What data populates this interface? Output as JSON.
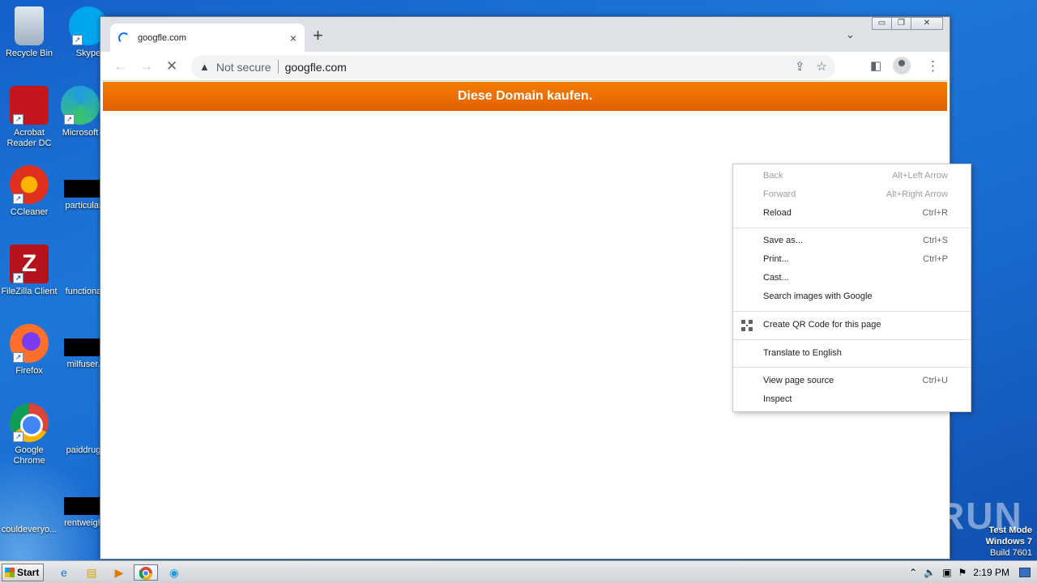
{
  "desktop": {
    "icons": [
      {
        "label": "Recycle Bin"
      },
      {
        "label": "Skype"
      },
      {
        "label": "Acrobat Reader DC"
      },
      {
        "label": "Microsoft"
      },
      {
        "label": "CCleaner"
      },
      {
        "label": "particular"
      },
      {
        "label": "FileZilla Client"
      },
      {
        "label": "functiona"
      },
      {
        "label": "Firefox"
      },
      {
        "label": "milfuser."
      },
      {
        "label": "Google Chrome"
      },
      {
        "label": "paiddrug"
      },
      {
        "label": "couldeveryo..."
      },
      {
        "label": "rentweigh"
      }
    ]
  },
  "browser": {
    "tab": {
      "title": "googfle.com",
      "close_icon": "×"
    },
    "new_tab_icon": "+",
    "tab_search_icon": "⌄",
    "window_buttons": {
      "minimize": "▭",
      "maximize": "❐",
      "close": "✕"
    },
    "toolbar": {
      "back_icon": "←",
      "forward_icon": "→",
      "stop_icon": "✕",
      "security_icon": "▲",
      "security_text": "Not secure",
      "url": "googfle.com",
      "share_icon": "⇪",
      "star_icon": "☆",
      "sidepanel_icon": "◧",
      "menu_icon": "⋮"
    },
    "page": {
      "banner_text": "Diese Domain kaufen.",
      "banner_color": "#f07000"
    }
  },
  "context_menu": {
    "items": [
      {
        "label": "Back",
        "shortcut": "Alt+Left Arrow",
        "disabled": true
      },
      {
        "label": "Forward",
        "shortcut": "Alt+Right Arrow",
        "disabled": true
      },
      {
        "label": "Reload",
        "shortcut": "Ctrl+R",
        "disabled": false
      },
      {
        "label": "Save as...",
        "shortcut": "Ctrl+S",
        "disabled": false
      },
      {
        "label": "Print...",
        "shortcut": "Ctrl+P",
        "disabled": false
      },
      {
        "label": "Cast...",
        "shortcut": "",
        "disabled": false
      },
      {
        "label": "Search images with Google",
        "shortcut": "",
        "disabled": false
      },
      {
        "label": "Create QR Code for this page",
        "shortcut": "",
        "disabled": false
      },
      {
        "label": "Translate to English",
        "shortcut": "",
        "disabled": false
      },
      {
        "label": "View page source",
        "shortcut": "Ctrl+U",
        "disabled": false
      },
      {
        "label": "Inspect",
        "shortcut": "",
        "disabled": false
      }
    ]
  },
  "watermark": "ANY RUN",
  "test_mode": {
    "line1": "Test Mode",
    "line2": "Windows 7",
    "line3": "Build 7601"
  },
  "taskbar": {
    "start_label": "Start",
    "clock": "2:19 PM",
    "tray_icons": [
      "chevron-up-icon",
      "speaker-icon",
      "network-icon",
      "flag-icon"
    ]
  }
}
